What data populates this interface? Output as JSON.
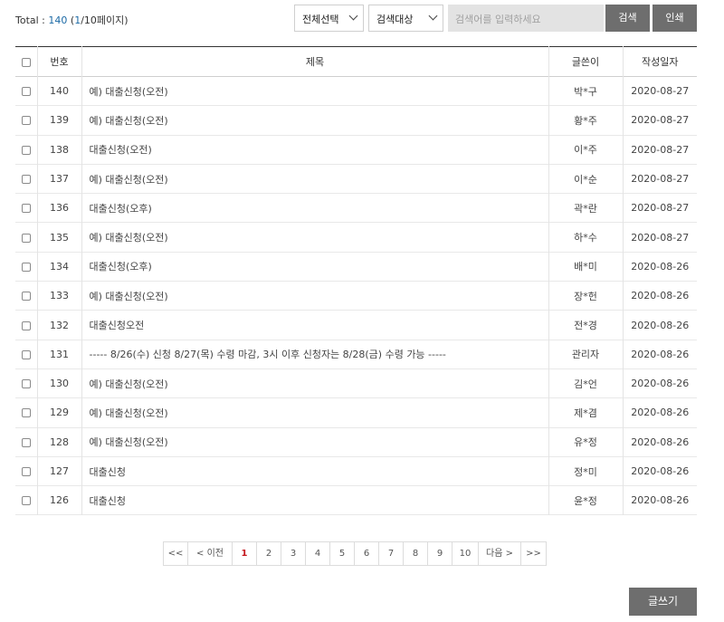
{
  "summary": {
    "label": "Total : ",
    "total": "140",
    "page_open": " (",
    "current_page": "1",
    "page_total": "/10",
    "page_suffix": "페이지)"
  },
  "search": {
    "select_all_label": "전체선택",
    "target_label": "검색대상",
    "placeholder": "검색어를 입력하세요",
    "search_button": "검색",
    "print_button": "인쇄"
  },
  "table": {
    "headers": {
      "number": "번호",
      "title": "제목",
      "author": "글쓴이",
      "date": "작성일자"
    },
    "rows": [
      {
        "number": "140",
        "title": "예) 대출신청(오전)",
        "author": "박*구",
        "date": "2020-08-27"
      },
      {
        "number": "139",
        "title": "예) 대출신청(오전)",
        "author": "황*주",
        "date": "2020-08-27"
      },
      {
        "number": "138",
        "title": "대출신청(오전)",
        "author": "이*주",
        "date": "2020-08-27"
      },
      {
        "number": "137",
        "title": "예) 대출신청(오전)",
        "author": "이*순",
        "date": "2020-08-27"
      },
      {
        "number": "136",
        "title": "대출신청(오후)",
        "author": "곽*란",
        "date": "2020-08-27"
      },
      {
        "number": "135",
        "title": "예) 대출신청(오전)",
        "author": "하*수",
        "date": "2020-08-27"
      },
      {
        "number": "134",
        "title": "대출신청(오후)",
        "author": "배*미",
        "date": "2020-08-26"
      },
      {
        "number": "133",
        "title": "예) 대출신청(오전)",
        "author": "장*헌",
        "date": "2020-08-26"
      },
      {
        "number": "132",
        "title": "대출신청오전",
        "author": "전*경",
        "date": "2020-08-26"
      },
      {
        "number": "131",
        "title": "----- 8/26(수) 신청 8/27(목) 수령 마감, 3시 이후 신청자는 8/28(금) 수령 가능 -----",
        "author": "관리자",
        "date": "2020-08-26"
      },
      {
        "number": "130",
        "title": "예) 대출신청(오전)",
        "author": "김*언",
        "date": "2020-08-26"
      },
      {
        "number": "129",
        "title": "예) 대출신청(오전)",
        "author": "제*겸",
        "date": "2020-08-26"
      },
      {
        "number": "128",
        "title": "예) 대출신청(오전)",
        "author": "유*정",
        "date": "2020-08-26"
      },
      {
        "number": "127",
        "title": "대출신청",
        "author": "정*미",
        "date": "2020-08-26"
      },
      {
        "number": "126",
        "title": "대출신청",
        "author": "윤*정",
        "date": "2020-08-26"
      }
    ]
  },
  "pagination": {
    "first": "<<",
    "prev": "< 이전",
    "pages": [
      "1",
      "2",
      "3",
      "4",
      "5",
      "6",
      "7",
      "8",
      "9",
      "10"
    ],
    "active_page": "1",
    "next": "다음 >",
    "last": ">>"
  },
  "write_button": "글쓰기",
  "colors": {
    "accent_blue": "#1c6aa6",
    "active_page": "#c4161c",
    "button_gray": "#6e6e6e"
  }
}
